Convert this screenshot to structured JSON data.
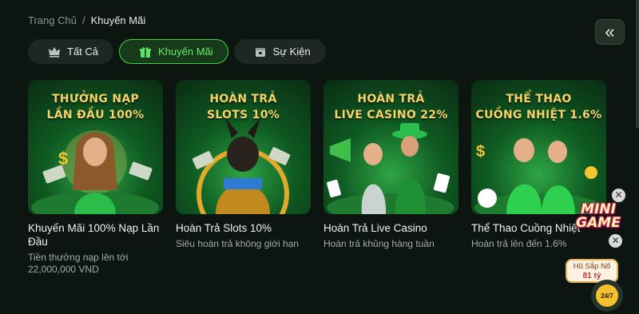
{
  "breadcrumb": {
    "home": "Trang Chủ",
    "separator": "/",
    "current": "Khuyến Mãi"
  },
  "tabs": [
    {
      "label": "Tất Cả",
      "icon": "crown-icon",
      "active": false
    },
    {
      "label": "Khuyến Mãi",
      "icon": "gift-icon",
      "active": true
    },
    {
      "label": "Sự Kiện",
      "icon": "calendar-icon",
      "active": false
    }
  ],
  "cards": [
    {
      "banner_line1": "THƯỞNG NẠP",
      "banner_line2": "LẦN ĐẦU 100%",
      "title": "Khuyến Mãi 100% Nạp Lần Đầu",
      "subtitle": "Tiền thưởng nạp lên tới 22,000,000 VND"
    },
    {
      "banner_line1": "HOÀN TRẢ",
      "banner_line2": "SLOTS 10%",
      "title": "Hoàn Trả Slots 10%",
      "subtitle": "Siêu hoàn trả không giới hạn"
    },
    {
      "banner_line1": "HOÀN TRẢ",
      "banner_line2": "LIVE CASINO 22%",
      "title": "Hoàn Trả Live Casino",
      "subtitle": "Hoàn trả khủng hàng tuần"
    },
    {
      "banner_line1": "THỂ THAO",
      "banner_line2": "CUỒNG NHIỆT 1.6%",
      "title": "Thể Thao Cuồng Nhiệt",
      "subtitle": "Hoàn trả lên đến 1.6%"
    }
  ],
  "collapse_button": {
    "icon": "double-chevron-left-icon",
    "glyph": "«"
  },
  "minigame": {
    "logo_line1": "MINI",
    "logo_line2": "GAME",
    "pot_label": "Hũ Sắp Nổ",
    "pot_amount": "81 tỷ",
    "close_glyph": "✕"
  },
  "support": {
    "label": "24/7",
    "icon": "headset-icon"
  },
  "colors": {
    "background": "#0c1510",
    "accent": "#3fd244",
    "banner_text": "#f5d36a"
  }
}
